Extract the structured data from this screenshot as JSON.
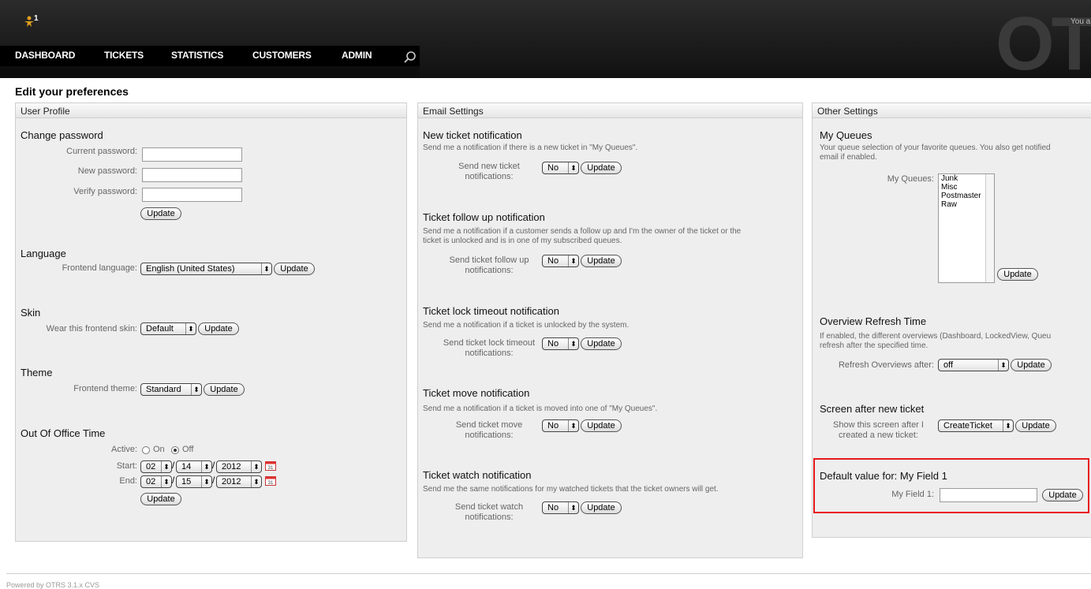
{
  "header": {
    "notification_count": "1",
    "nav": [
      "DASHBOARD",
      "TICKETS",
      "STATISTICS",
      "CUSTOMERS",
      "ADMIN"
    ],
    "brand_letters": "OT",
    "user_text": "You a"
  },
  "page": {
    "title": "Edit your preferences"
  },
  "user_profile": {
    "header": "User Profile",
    "password": {
      "title": "Change password",
      "current_label": "Current password:",
      "new_label": "New password:",
      "verify_label": "Verify password:",
      "update": "Update"
    },
    "language": {
      "title": "Language",
      "label": "Frontend language:",
      "value": "English (United States)",
      "update": "Update"
    },
    "skin": {
      "title": "Skin",
      "label": "Wear this frontend skin:",
      "value": "Default",
      "update": "Update"
    },
    "theme": {
      "title": "Theme",
      "label": "Frontend theme:",
      "value": "Standard",
      "update": "Update"
    },
    "out_of_office": {
      "title": "Out Of Office Time",
      "active_label": "Active:",
      "on_label": "On",
      "off_label": "Off",
      "selected": "Off",
      "start_label": "Start:",
      "end_label": "End:",
      "start": {
        "month": "02",
        "day": "14",
        "year": "2012"
      },
      "end": {
        "month": "02",
        "day": "15",
        "year": "2012"
      },
      "update": "Update"
    }
  },
  "email_settings": {
    "header": "Email Settings",
    "new_ticket": {
      "title": "New ticket notification",
      "desc": "Send me a notification if there is a new ticket in \"My Queues\".",
      "label_line1": "Send new ticket",
      "label_line2": "notifications:",
      "value": "No",
      "update": "Update"
    },
    "follow_up": {
      "title": "Ticket follow up notification",
      "desc_line1": "Send me a notification if a customer sends a follow up and I'm the owner of the ticket or the",
      "desc_line2": "ticket is unlocked and is in one of my subscribed queues.",
      "label_line1": "Send ticket follow up",
      "label_line2": "notifications:",
      "value": "No",
      "update": "Update"
    },
    "lock_timeout": {
      "title": "Ticket lock timeout notification",
      "desc": "Send me a notification if a ticket is unlocked by the system.",
      "label_line1": "Send ticket lock timeout",
      "label_line2": "notifications:",
      "value": "No",
      "update": "Update"
    },
    "move": {
      "title": "Ticket move notification",
      "desc": "Send me a notification if a ticket is moved into one of \"My Queues\".",
      "label_line1": "Send ticket move",
      "label_line2": "notifications:",
      "value": "No",
      "update": "Update"
    },
    "watch": {
      "title": "Ticket watch notification",
      "desc": "Send me the same notifications for my watched tickets that the ticket owners will get.",
      "label_line1": "Send ticket watch",
      "label_line2": "notifications:",
      "value": "No",
      "update": "Update"
    }
  },
  "other_settings": {
    "header": "Other Settings",
    "my_queues": {
      "title": "My Queues",
      "desc_line1": "Your queue selection of your favorite queues. You also get notified",
      "desc_line2": "email if enabled.",
      "label": "My Queues:",
      "options": [
        "Junk",
        "Misc",
        "Postmaster",
        "Raw"
      ],
      "update": "Update"
    },
    "refresh": {
      "title": "Overview Refresh Time",
      "desc_line1": "If enabled, the different overviews (Dashboard, LockedView, Queu",
      "desc_line2": "refresh after the specified time.",
      "label": "Refresh Overviews after:",
      "value": "off",
      "update": "Update"
    },
    "screen_after": {
      "title": "Screen after new ticket",
      "label_line1": "Show this screen after I",
      "label_line2": "created a new ticket:",
      "value": "CreateTicket",
      "update": "Update"
    },
    "default_value": {
      "title": "Default value for: My Field 1",
      "label": "My Field 1:",
      "update": "Update"
    }
  },
  "footer": {
    "text": "Powered by OTRS 3.1.x CVS"
  }
}
